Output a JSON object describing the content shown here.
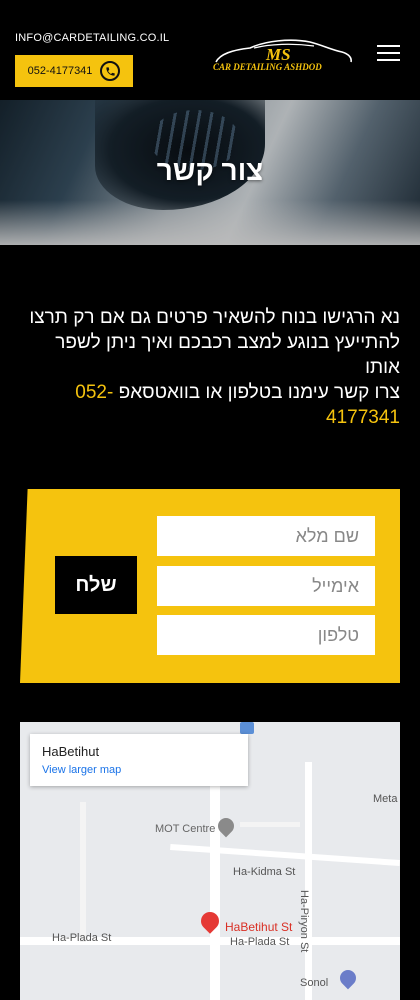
{
  "header": {
    "email": "INFO@CARDETAILING.CO.IL",
    "phone": "052-4177341",
    "logo_mark": "MS",
    "logo_text": "CAR DETAILING ASHDOD"
  },
  "hero": {
    "title": "צור קשר"
  },
  "intro": {
    "text": "נא הרגישו בנוח להשאיר פרטים גם אם רק תרצו להתייעץ בנוגע למצב רכבכם ואיך ניתן לשפר אותו",
    "cta": "צרו קשר עימנו בטלפון או בוואטסאפ",
    "phone": "052-4177341"
  },
  "form": {
    "name_placeholder": "שם מלא",
    "email_placeholder": "אימייל",
    "phone_placeholder": "טלפון",
    "submit_label": "שלח"
  },
  "map": {
    "place_title": "HaBetihut",
    "larger_map_link": "View larger map",
    "labels": {
      "meta": "Meta",
      "mot_centre": "MOT Centre",
      "ha_kidma": "Ha-Kidma St",
      "ha_piryon": "Ha-Piryon St",
      "habetihut_pin": "HaBetihut St",
      "ha_plada_1": "Ha-Plada St",
      "ha_plada_2": "Ha-Plada St",
      "sonol": "Sonol"
    }
  },
  "colors": {
    "accent": "#f5c30e",
    "background": "#000000",
    "link": "#1a73e8",
    "pin": "#e53935"
  }
}
